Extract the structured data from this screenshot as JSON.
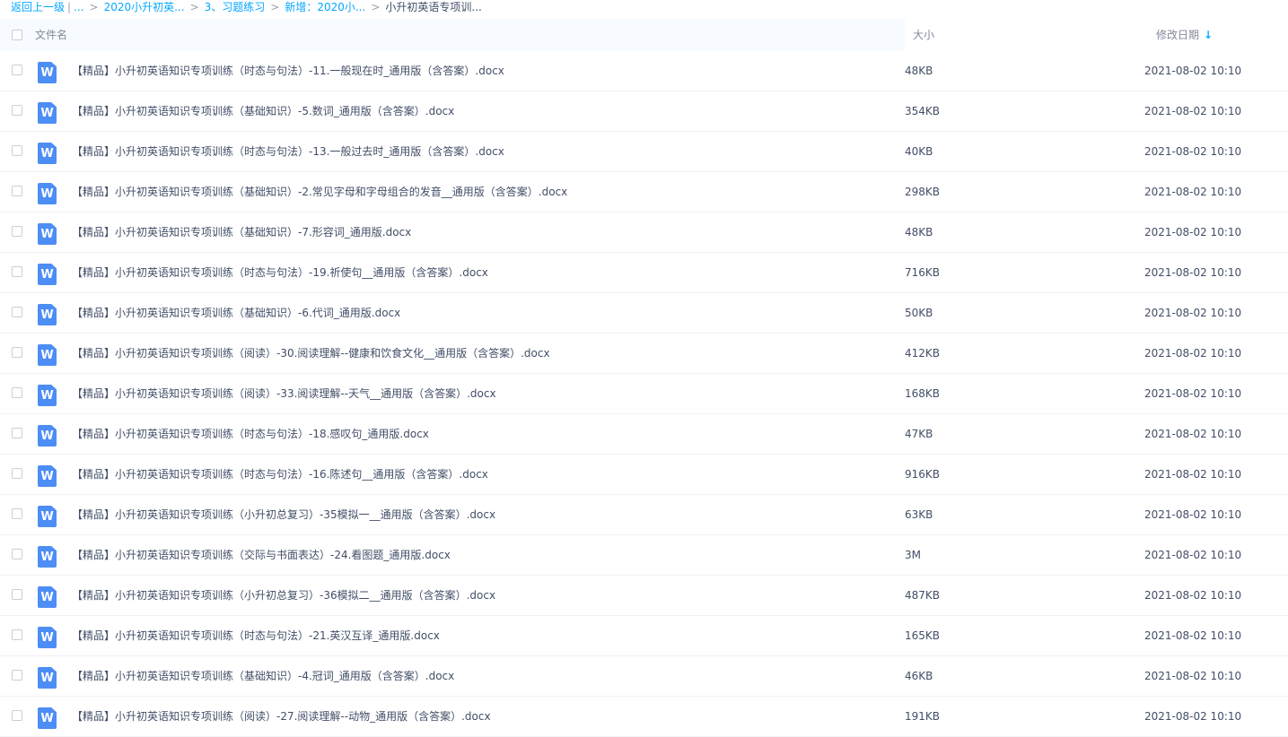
{
  "breadcrumb": {
    "back": "返回上一级",
    "ellipsis": "...",
    "items": [
      "2020小升初英...",
      "3、习题练习",
      "新增：2020小..."
    ],
    "current": "小升初英语专项训...",
    "separator": ">",
    "divider": "|"
  },
  "header": {
    "name": "文件名",
    "size": "大小",
    "date": "修改日期",
    "sort_icon": "↓"
  },
  "file_icon_letter": "W",
  "files": [
    {
      "name": "【精品】小升初英语知识专项训练（时态与句法）-11.一般现在时_通用版（含答案）.docx",
      "size": "48KB",
      "date": "2021-08-02 10:10"
    },
    {
      "name": "【精品】小升初英语知识专项训练（基础知识）-5.数词_通用版（含答案）.docx",
      "size": "354KB",
      "date": "2021-08-02 10:10"
    },
    {
      "name": "【精品】小升初英语知识专项训练（时态与句法）-13.一般过去时_通用版（含答案）.docx",
      "size": "40KB",
      "date": "2021-08-02 10:10"
    },
    {
      "name": "【精品】小升初英语知识专项训练（基础知识）-2.常见字母和字母组合的发音__通用版（含答案）.docx",
      "size": "298KB",
      "date": "2021-08-02 10:10"
    },
    {
      "name": "【精品】小升初英语知识专项训练（基础知识）-7.形容词_通用版.docx",
      "size": "48KB",
      "date": "2021-08-02 10:10"
    },
    {
      "name": "【精品】小升初英语知识专项训练（时态与句法）-19.祈使句__通用版（含答案）.docx",
      "size": "716KB",
      "date": "2021-08-02 10:10"
    },
    {
      "name": "【精品】小升初英语知识专项训练（基础知识）-6.代词_通用版.docx",
      "size": "50KB",
      "date": "2021-08-02 10:10"
    },
    {
      "name": "【精品】小升初英语知识专项训练（阅读）-30.阅读理解--健康和饮食文化__通用版（含答案）.docx",
      "size": "412KB",
      "date": "2021-08-02 10:10"
    },
    {
      "name": "【精品】小升初英语知识专项训练（阅读）-33.阅读理解--天气__通用版（含答案）.docx",
      "size": "168KB",
      "date": "2021-08-02 10:10"
    },
    {
      "name": "【精品】小升初英语知识专项训练（时态与句法）-18.感叹句_通用版.docx",
      "size": "47KB",
      "date": "2021-08-02 10:10"
    },
    {
      "name": "【精品】小升初英语知识专项训练（时态与句法）-16.陈述句__通用版（含答案）.docx",
      "size": "916KB",
      "date": "2021-08-02 10:10"
    },
    {
      "name": "【精品】小升初英语知识专项训练（小升初总复习）-35模拟一__通用版（含答案）.docx",
      "size": "63KB",
      "date": "2021-08-02 10:10"
    },
    {
      "name": "【精品】小升初英语知识专项训练（交际与书面表达）-24.看图题_通用版.docx",
      "size": "3M",
      "date": "2021-08-02 10:10"
    },
    {
      "name": "【精品】小升初英语知识专项训练（小升初总复习）-36模拟二__通用版（含答案）.docx",
      "size": "487KB",
      "date": "2021-08-02 10:10"
    },
    {
      "name": "【精品】小升初英语知识专项训练（时态与句法）-21.英汉互译_通用版.docx",
      "size": "165KB",
      "date": "2021-08-02 10:10"
    },
    {
      "name": "【精品】小升初英语知识专项训练（基础知识）-4.冠词_通用版（含答案）.docx",
      "size": "46KB",
      "date": "2021-08-02 10:10"
    },
    {
      "name": "【精品】小升初英语知识专项训练（阅读）-27.阅读理解--动物_通用版（含答案）.docx",
      "size": "191KB",
      "date": "2021-08-02 10:10"
    }
  ],
  "colors": {
    "link": "#06a7ff",
    "word_icon": "#4d8df6",
    "header_bg": "#f7faff",
    "text": "#424e67"
  }
}
